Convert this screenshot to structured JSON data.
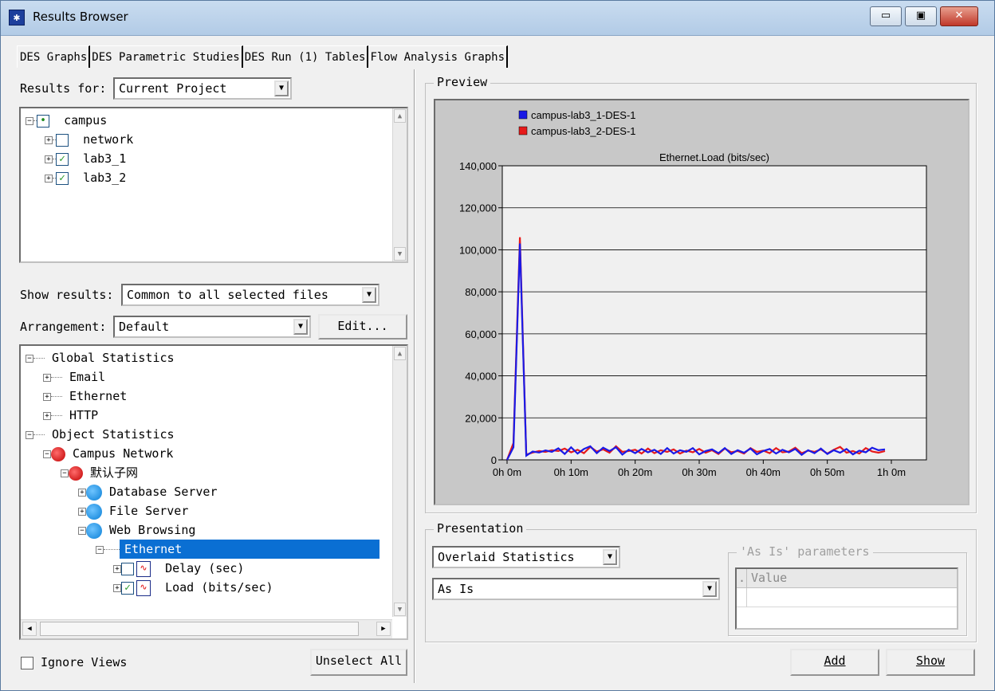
{
  "window": {
    "title": "Results Browser",
    "min_label": "▭",
    "max_label": "▣",
    "close_label": "✕"
  },
  "tabs": [
    "DES Graphs",
    "DES Parametric Studies",
    "DES Run (1) Tables",
    "Flow Analysis Graphs"
  ],
  "results_for": {
    "label": "Results for:",
    "value": "Current Project"
  },
  "project_tree": [
    {
      "label": "campus",
      "expander": "−",
      "check": "•"
    },
    {
      "label": "network",
      "expander": "+",
      "check": ""
    },
    {
      "label": "lab3_1",
      "expander": "+",
      "check": "✓"
    },
    {
      "label": "lab3_2",
      "expander": "+",
      "check": "✓"
    }
  ],
  "show_results": {
    "label": "Show results:",
    "value": "Common to all selected files"
  },
  "arrangement": {
    "label": "Arrangement:",
    "value": "Default",
    "edit_label": "Edit..."
  },
  "stats_tree": {
    "global": "Global Statistics",
    "email": "Email",
    "ethernet": "Ethernet",
    "http": "HTTP",
    "object": "Object Statistics",
    "campus_network": "Campus Network",
    "subnet": "默认子网",
    "db_server": "Database Server",
    "file_server": "File Server",
    "web_browsing": "Web Browsing",
    "ethernet_sel": "Ethernet",
    "delay": "Delay (sec)",
    "load": "Load (bits/sec)"
  },
  "ignore_views": "Ignore Views",
  "unselect_all": "Unselect All",
  "preview_label": "Preview",
  "chart_data": {
    "type": "line",
    "title": "Ethernet.Load (bits/sec)",
    "ylim": [
      0,
      140000
    ],
    "yticks": [
      "0",
      "20,000",
      "40,000",
      "60,000",
      "80,000",
      "100,000",
      "120,000",
      "140,000"
    ],
    "xticks": [
      "0h 0m",
      "0h 10m",
      "0h 20m",
      "0h 30m",
      "0h 40m",
      "0h 50m",
      "1h 0m"
    ],
    "x_minutes": [
      0,
      1,
      2,
      3,
      4,
      5,
      6,
      7,
      8,
      9,
      10,
      11,
      12,
      13,
      14,
      15,
      16,
      17,
      18,
      19,
      20,
      21,
      22,
      23,
      24,
      25,
      26,
      27,
      28,
      29,
      30,
      31,
      32,
      33,
      34,
      35,
      36,
      37,
      38,
      39,
      40,
      41,
      42,
      43,
      44,
      45,
      46,
      47,
      48,
      49,
      50,
      51,
      52,
      53,
      54,
      55,
      56,
      57,
      58,
      59
    ],
    "series": [
      {
        "name": "campus-lab3_1-DES-1",
        "color": "#1a1ae6",
        "values": [
          0,
          6000,
          103000,
          2000,
          4000,
          3500,
          4500,
          3800,
          5500,
          2800,
          6000,
          3000,
          5200,
          6500,
          3200,
          5800,
          4200,
          6000,
          2500,
          4800,
          3200,
          5200,
          3600,
          4800,
          2800,
          5600,
          3000,
          4600,
          3800,
          5600,
          2600,
          4200,
          5000,
          3200,
          5600,
          2800,
          4600,
          3400,
          5400,
          2600,
          4200,
          5200,
          3000,
          4800,
          3600,
          5200,
          2400,
          4600,
          3200,
          5400,
          2800,
          4600,
          3400,
          5200,
          2600,
          4400,
          3600,
          5800,
          4600,
          5000
        ]
      },
      {
        "name": "campus-lab3_2-DES-1",
        "color": "#e61a1a",
        "values": [
          0,
          8000,
          106000,
          2500,
          3500,
          4200,
          3800,
          4600,
          4200,
          5400,
          3600,
          4800,
          3200,
          6200,
          4000,
          5000,
          3400,
          6500,
          3800,
          4200,
          4800,
          3000,
          5400,
          3200,
          4600,
          3800,
          5000,
          3000,
          4400,
          3600,
          5200,
          3400,
          4600,
          2800,
          5400,
          3600,
          4200,
          3000,
          5600,
          3800,
          4400,
          3200,
          5600,
          3600,
          4000,
          5800,
          3200,
          4400,
          3800,
          5000,
          3000,
          4800,
          6200,
          3400,
          4200,
          3000,
          5600,
          4000,
          3400,
          4200
        ]
      }
    ]
  },
  "presentation": {
    "label": "Presentation",
    "mode": "Overlaid Statistics",
    "filter": "As Is",
    "params_label": "'As Is' parameters",
    "col_marker": ".",
    "col_value": "Value"
  },
  "buttons": {
    "add": "Add",
    "show": "Show"
  }
}
